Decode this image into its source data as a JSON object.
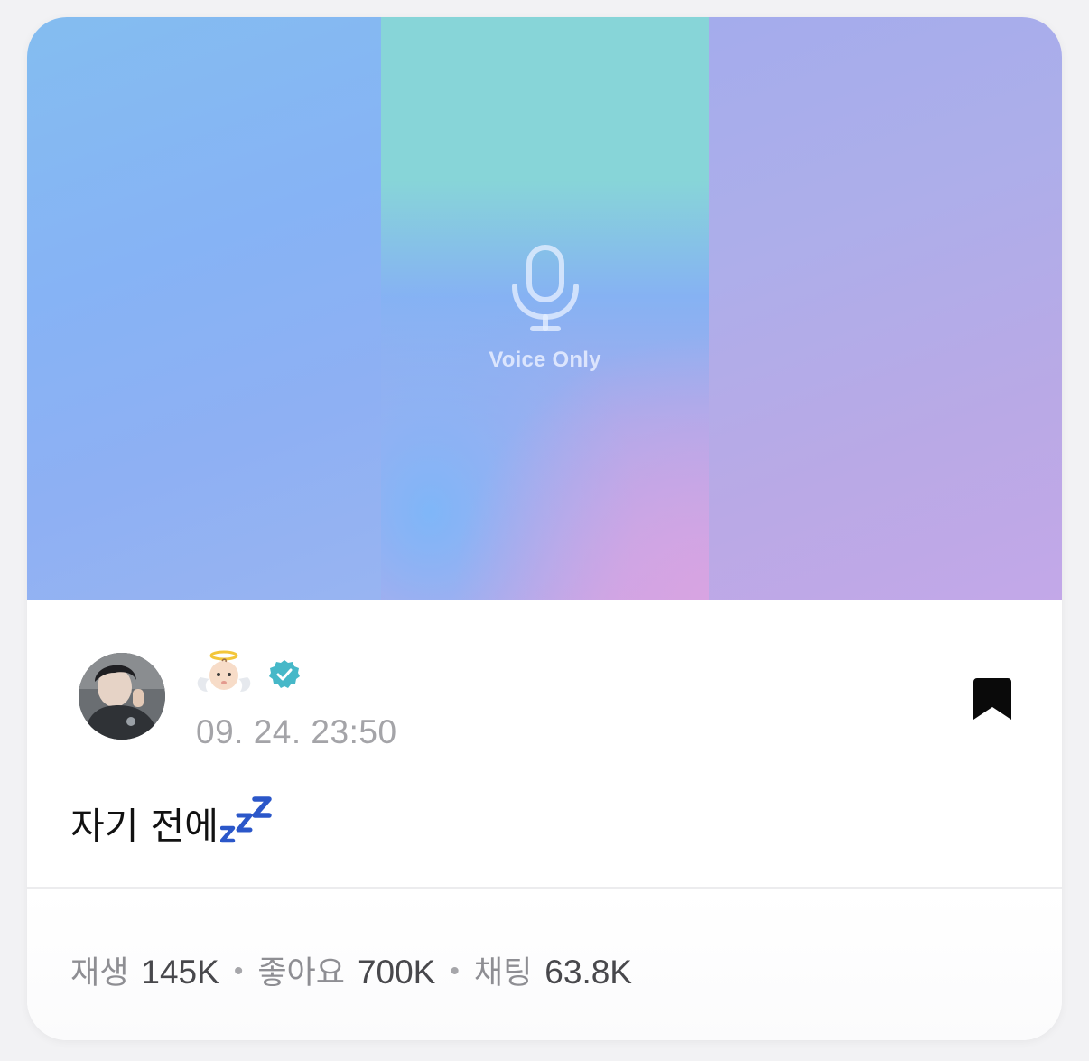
{
  "media": {
    "voice_label": "Voice Only",
    "icon": "microphone-icon"
  },
  "post": {
    "author_emoji": "baby-angel-emoji",
    "verified_icon": "verified-badge-icon",
    "verified_color": "#46b8c8",
    "timestamp": "09. 24. 23:50",
    "text": "자기 전에",
    "text_emoji": "zzz-icon",
    "bookmark_icon": "bookmark-icon"
  },
  "stats": {
    "plays_label": "재생",
    "plays_value": "145K",
    "likes_label": "좋아요",
    "likes_value": "700K",
    "chats_label": "채팅",
    "chats_value": "63.8K",
    "separator": "•"
  }
}
